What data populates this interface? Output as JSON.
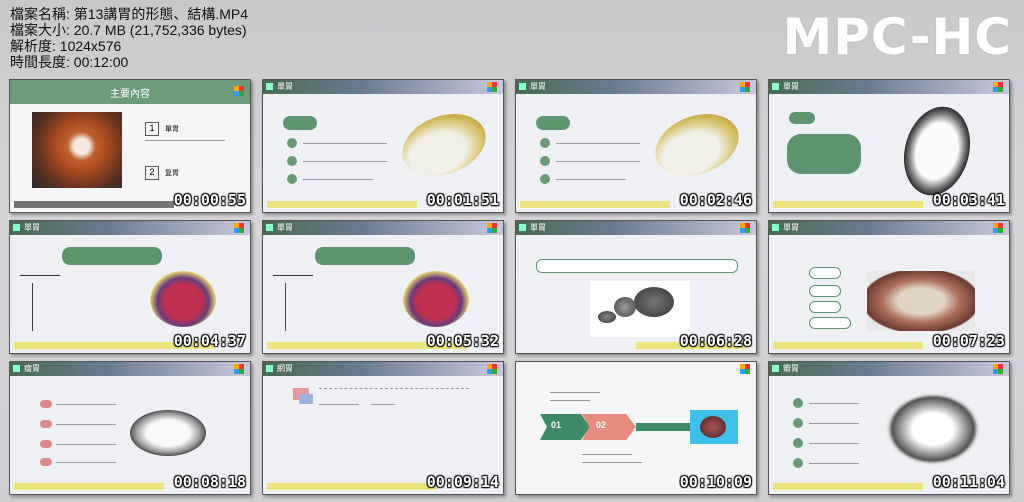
{
  "file_info": {
    "name_label": "檔案名稱:",
    "name": "第13講胃的形態、結構.MP4",
    "size_label": "檔案大小:",
    "size": "20.7 MB (21,752,336 bytes)",
    "resolution_label": "解析度:",
    "resolution": "1024x576",
    "duration_label": "時間長度:",
    "duration": "00:12:00"
  },
  "brand": "MPC-HC",
  "thumbnails": [
    {
      "timestamp": "00:00:55",
      "title": "主要內容",
      "item1": "單胃",
      "item2": "复胃"
    },
    {
      "timestamp": "00:01:51",
      "title": "單胃"
    },
    {
      "timestamp": "00:02:46",
      "title": "單胃"
    },
    {
      "timestamp": "00:03:41",
      "title": "單胃"
    },
    {
      "timestamp": "00:04:37",
      "title": "單胃"
    },
    {
      "timestamp": "00:05:32",
      "title": "單胃"
    },
    {
      "timestamp": "00:06:28",
      "title": "單胃"
    },
    {
      "timestamp": "00:07:23",
      "title": "單胃"
    },
    {
      "timestamp": "00:08:18",
      "title": "瘤胃"
    },
    {
      "timestamp": "00:09:14",
      "title": "網胃"
    },
    {
      "timestamp": "00:10:09",
      "title": "",
      "step1": "01",
      "step2": "02"
    },
    {
      "timestamp": "00:11:04",
      "title": "瓣胃"
    }
  ]
}
